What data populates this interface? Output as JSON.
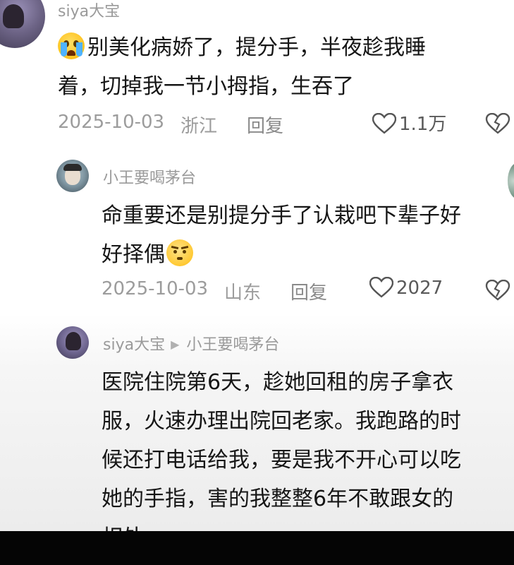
{
  "comments": [
    {
      "username": "siya大宝",
      "text_line1": "别美化病娇了，提分手，半夜趁我睡",
      "text_line2": "着，切掉我一节小拇指，生吞了",
      "date": "2025-10-03",
      "location": "浙江",
      "reply_label": "回复",
      "likes": "1.1万"
    },
    {
      "username": "小王要喝茅台",
      "text_line1": "命重要还是别提分手了认栽吧下辈子好",
      "text_line2": "好择偶",
      "date": "2025-10-03",
      "location": "山东",
      "reply_label": "回复",
      "likes": "2027"
    },
    {
      "username": "siya大宝",
      "reply_to": "小王要喝茅台",
      "text_lines": [
        "医院住院第6天，趁她回租的房子拿衣",
        "服，火速办理出院回老家。我跑路的时",
        "候还打电话给我，要是我不开心可以吃",
        "她的手指，害的我整整6年不敢跟女的",
        "相处。"
      ]
    }
  ],
  "icons": {
    "like": "heart-outline-icon",
    "dislike": "broken-heart-icon",
    "reply_arrow": "triangle-right-icon"
  },
  "colors": {
    "meta_text": "#9c9c9c",
    "body_text": "#161616",
    "bottom_bar": "#050505"
  }
}
